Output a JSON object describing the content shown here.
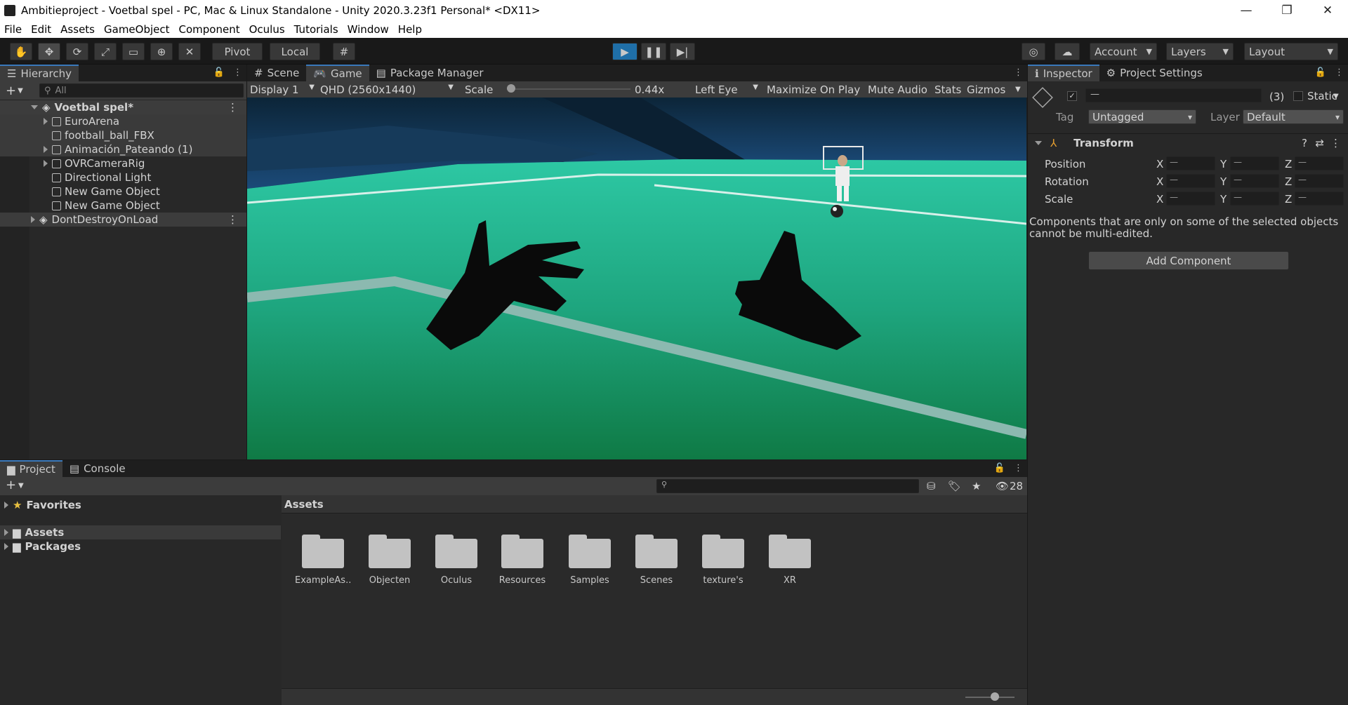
{
  "window": {
    "title": "Ambitieproject - Voetbal spel - PC, Mac & Linux Standalone - Unity 2020.3.23f1 Personal* <DX11>",
    "min": "—",
    "max": "❐",
    "close": "✕"
  },
  "menu": [
    "File",
    "Edit",
    "Assets",
    "GameObject",
    "Component",
    "Oculus",
    "Tutorials",
    "Window",
    "Help"
  ],
  "toolbar": {
    "pivot": "Pivot",
    "local": "Local",
    "account": "Account",
    "layers": "Layers",
    "layout": "Layout"
  },
  "hierarchy": {
    "tab": "Hierarchy",
    "search_placeholder": "All",
    "scene": "Voetbal spel*",
    "items": [
      "EuroArena",
      "football_ball_FBX",
      "Animación_Pateando (1)",
      "OVRCameraRig",
      "Directional Light",
      "New Game Object",
      "New Game Object"
    ],
    "dontdestroy": "DontDestroyOnLoad"
  },
  "center_tabs": {
    "scene": "Scene",
    "game": "Game",
    "package": "Package Manager"
  },
  "game_bar": {
    "display": "Display 1",
    "resolution": "QHD (2560x1440)",
    "scale_label": "Scale",
    "scale_value": "0.44x",
    "eye": "Left Eye",
    "maximize": "Maximize On Play",
    "mute": "Mute Audio",
    "stats": "Stats",
    "gizmos": "Gizmos"
  },
  "inspector": {
    "tab": "Inspector",
    "tab2": "Project Settings",
    "name_value": "—",
    "count": "(3)",
    "static": "Static",
    "tag_label": "Tag",
    "tag_value": "Untagged",
    "layer_label": "Layer",
    "layer_value": "Default",
    "transform": "Transform",
    "rows": [
      "Position",
      "Rotation",
      "Scale"
    ],
    "axes": [
      "X",
      "Y",
      "Z"
    ],
    "field_value": "—",
    "note": "Components that are only on some of the selected objects cannot be multi-edited.",
    "add_component": "Add Component"
  },
  "project": {
    "tab": "Project",
    "tab2": "Console",
    "favorites": "Favorites",
    "assets": "Assets",
    "packages": "Packages",
    "breadcrumb": "Assets",
    "hidden_count": "28",
    "folders": [
      "ExampleAs...",
      "Objecten",
      "Oculus",
      "Resources",
      "Samples",
      "Scenes",
      "texture's",
      "XR"
    ]
  }
}
